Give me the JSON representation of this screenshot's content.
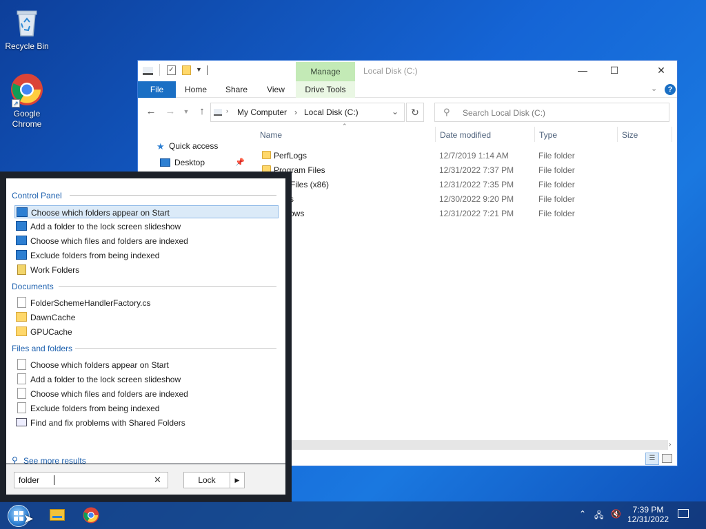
{
  "desktop": {
    "icons": [
      {
        "label": "Recycle Bin",
        "icon": "recycle-bin-icon"
      },
      {
        "label": "Google Chrome",
        "icon": "chrome-icon"
      }
    ]
  },
  "explorer": {
    "title": "Local Disk (C:)",
    "contextual_tab": "Manage",
    "tabs": [
      "File",
      "Home",
      "Share",
      "View",
      "Drive Tools"
    ],
    "address": {
      "root": "My Computer",
      "current": "Local Disk (C:)"
    },
    "search_placeholder": "Search Local Disk (C:)",
    "columns": [
      "Name",
      "Date modified",
      "Type",
      "Size"
    ],
    "nav_pane": [
      {
        "label": "Quick access",
        "icon": "star-icon"
      },
      {
        "label": "Desktop",
        "icon": "desktop-icon"
      }
    ],
    "rows": [
      {
        "name": "PerfLogs",
        "date": "12/7/2019 1:14 AM",
        "type": "File folder"
      },
      {
        "name": "Program Files",
        "date": "12/31/2022 7:37 PM",
        "type": "File folder"
      },
      {
        "name": "ram Files (x86)",
        "date": "12/31/2022 7:35 PM",
        "type": "File folder"
      },
      {
        "name": "s",
        "date": "12/30/2022 9:20 PM",
        "type": "File folder"
      },
      {
        "name": "ows",
        "date": "12/31/2022 7:21 PM",
        "type": "File folder"
      }
    ]
  },
  "search_panel": {
    "sections": [
      {
        "title": "Control Panel",
        "items": [
          {
            "label": "Choose which folders appear on Start",
            "icon": "control-panel-icon",
            "selected": true
          },
          {
            "label": "Add a folder to the lock screen slideshow",
            "icon": "control-panel-icon"
          },
          {
            "label": "Choose which files and folders are indexed",
            "icon": "control-panel-icon"
          },
          {
            "label": "Exclude folders from being indexed",
            "icon": "control-panel-icon"
          },
          {
            "label": "Work Folders",
            "icon": "work-folders-icon"
          }
        ]
      },
      {
        "title": "Documents",
        "items": [
          {
            "label": "FolderSchemeHandlerFactory.cs",
            "icon": "document-icon"
          },
          {
            "label": "DawnCache",
            "icon": "folder-icon"
          },
          {
            "label": "GPUCache",
            "icon": "folder-icon"
          }
        ]
      },
      {
        "title": "Files and folders",
        "items": [
          {
            "label": "Choose which folders appear on Start",
            "icon": "document-icon"
          },
          {
            "label": "Add a folder to the lock screen slideshow",
            "icon": "document-icon"
          },
          {
            "label": "Choose which files and folders are indexed",
            "icon": "document-icon"
          },
          {
            "label": "Exclude folders from being indexed",
            "icon": "document-icon"
          },
          {
            "label": "Find and fix problems with Shared Folders",
            "icon": "troubleshoot-icon"
          }
        ]
      }
    ],
    "see_more": "See more results",
    "query": "folder",
    "lock_label": "Lock",
    "arrow_label": "▶"
  },
  "taskbar": {
    "time": "7:39 PM",
    "date": "12/31/2022",
    "pinned": [
      "start-icon",
      "file-explorer-icon",
      "chrome-icon"
    ]
  },
  "colors": {
    "accent": "#1a6fc4",
    "manage_tab": "#c3eab6",
    "section_title": "#1b5fae"
  }
}
